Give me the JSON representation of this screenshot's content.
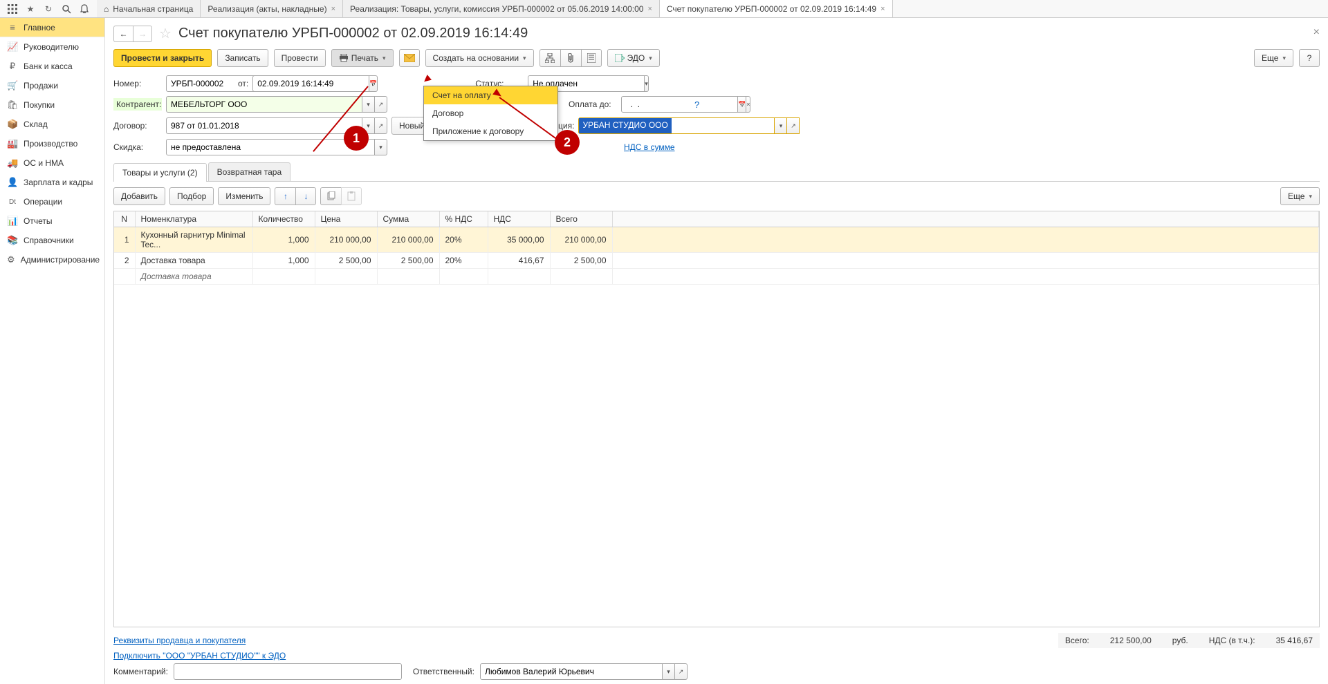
{
  "tabs": {
    "home": "Начальная страница",
    "t1": "Реализация (акты, накладные)",
    "t2": "Реализация: Товары, услуги, комиссия УРБП-000002 от 05.06.2019 14:00:00",
    "t3": "Счет покупателю УРБП-000002 от 02.09.2019 16:14:49"
  },
  "sidebar": {
    "items": [
      {
        "icon": "≡",
        "label": "Главное"
      },
      {
        "icon": "📈",
        "label": "Руководителю"
      },
      {
        "icon": "₽",
        "label": "Банк и касса"
      },
      {
        "icon": "🛒",
        "label": "Продажи"
      },
      {
        "icon": "🛍",
        "label": "Покупки"
      },
      {
        "icon": "📦",
        "label": "Склад"
      },
      {
        "icon": "🏭",
        "label": "Производство"
      },
      {
        "icon": "🚚",
        "label": "ОС и НМА"
      },
      {
        "icon": "👤",
        "label": "Зарплата и кадры"
      },
      {
        "icon": "Dt",
        "label": "Операции"
      },
      {
        "icon": "📊",
        "label": "Отчеты"
      },
      {
        "icon": "📚",
        "label": "Справочники"
      },
      {
        "icon": "⚙",
        "label": "Администрирование"
      }
    ]
  },
  "doc": {
    "title": "Счет покупателю УРБП-000002 от 02.09.2019 16:14:49"
  },
  "toolbar": {
    "post_close": "Провести и закрыть",
    "write": "Записать",
    "post": "Провести",
    "print": "Печать",
    "create_based": "Создать на основании",
    "edo": "ЭДО",
    "more": "Еще"
  },
  "print_menu": {
    "invoice": "Счет на оплату",
    "contract": "Договор",
    "appendix": "Приложение к договору"
  },
  "form": {
    "number_lbl": "Номер:",
    "number": "УРБП-000002",
    "from_lbl": "от:",
    "date": "02.09.2019 16:14:49",
    "status_lbl": "Статус:",
    "status_val": "Не оплачен",
    "counterparty_lbl": "Контрагент:",
    "counterparty": "МЕБЕЛЬТОРГ ООО",
    "pay_until_lbl": "Оплата до:",
    "pay_until_val": "  .  .",
    "contract_lbl": "Договор:",
    "contract": "987 от 01.01.2018",
    "new_btn": "Новый",
    "org_lbl_suffix": "ция:",
    "org": "УРБАН СТУДИО ООО",
    "discount_lbl": "Скидка:",
    "discount": "не предоставлена",
    "vat_link": "НДС в сумме"
  },
  "sub_tabs": {
    "goods": "Товары и услуги (2)",
    "returnable": "Возвратная тара"
  },
  "table_toolbar": {
    "add": "Добавить",
    "pick": "Подбор",
    "change": "Изменить",
    "more": "Еще"
  },
  "table": {
    "cols": {
      "n": "N",
      "item": "Номенклатура",
      "qty": "Количество",
      "price": "Цена",
      "sum": "Сумма",
      "vat_pct": "% НДС",
      "vat": "НДС",
      "total": "Всего"
    },
    "rows": [
      {
        "n": "1",
        "item": "Кухонный гарнитур Minimal Tec...",
        "qty": "1,000",
        "price": "210 000,00",
        "sum": "210 000,00",
        "vat_pct": "20%",
        "vat": "35 000,00",
        "total": "210 000,00"
      },
      {
        "n": "2",
        "item": "Доставка товара",
        "qty": "1,000",
        "price": "2 500,00",
        "sum": "2 500,00",
        "vat_pct": "20%",
        "vat": "416,67",
        "total": "2 500,00"
      }
    ],
    "extra_row": "Доставка товара"
  },
  "footer": {
    "seller_details": "Реквизиты продавца и покупателя",
    "totals_lbl": "Всего:",
    "totals_sum": "212 500,00",
    "currency": "руб.",
    "vat_lbl": "НДС (в т.ч.):",
    "vat_sum": "35 416,67",
    "edo_connect": "Подключить \"ООО \"УРБАН СТУДИО\"\" к ЭДО",
    "comment_lbl": "Комментарий:",
    "responsible_lbl": "Ответственный:",
    "responsible": "Любимов Валерий Юрьевич"
  },
  "callouts": {
    "c1": "1",
    "c2": "2"
  }
}
